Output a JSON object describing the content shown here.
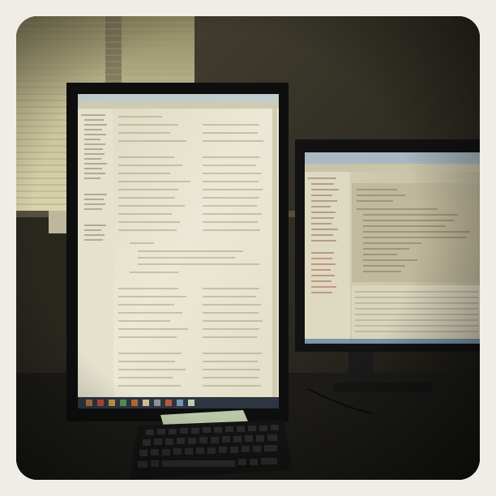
{
  "scene": {
    "description_label": "",
    "colors": {
      "frame": "#efeee6",
      "wall": "#3a3629",
      "window_light": "#cfc9a2",
      "screen_glow": "#e6e2cc",
      "bezel": "#141414",
      "desk": "#1e1d19"
    },
    "objects": [
      {
        "name": "window-blinds",
        "icon": "window-blinds-icon"
      },
      {
        "name": "portrait-monitor",
        "icon": "monitor-icon"
      },
      {
        "name": "landscape-monitor",
        "icon": "monitor-icon"
      },
      {
        "name": "keyboard",
        "icon": "keyboard-icon"
      },
      {
        "name": "notepad",
        "icon": "notepad-icon"
      }
    ]
  }
}
